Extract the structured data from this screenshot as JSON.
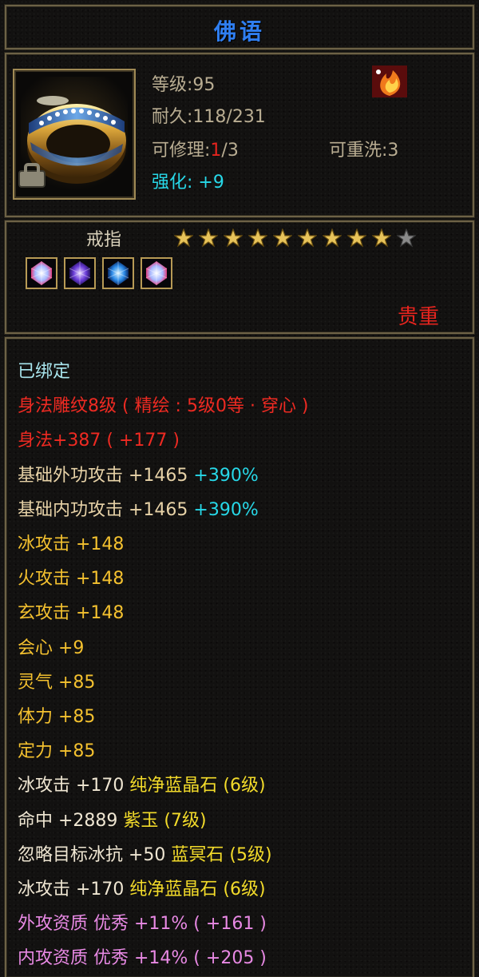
{
  "title": "佛语",
  "info": {
    "level": "等级:95",
    "durability": "耐久:118/231",
    "repair_label": "可修理:",
    "repair_current": "1",
    "repair_max": "/3",
    "rewash": "可重洗:3",
    "enhance_label": "强化:",
    "enhance_value": "+9"
  },
  "item": {
    "type": "戒指",
    "stars_filled": 9,
    "stars_total": 10,
    "rarity": "贵重",
    "gems": [
      "gem-crystal-icon",
      "gem-violet-icon",
      "gem-blue-icon",
      "gem-crystal-icon"
    ]
  },
  "colors": {
    "title": "#2f7ef0",
    "red": "#e5241e",
    "cyan": "#27d8e8",
    "gold": "#f4c12f",
    "pink": "#e889e4",
    "border": "#6d6246"
  },
  "attributes": [
    {
      "segments": [
        {
          "text": "已绑定",
          "color": "bind"
        }
      ]
    },
    {
      "segments": [
        {
          "text": "身法雕纹8级 ( 精绘 : 5级0等 · 穿心 )",
          "color": "red"
        }
      ]
    },
    {
      "segments": [
        {
          "text": "身法+387 ( +177 )",
          "color": "red"
        }
      ]
    },
    {
      "segments": [
        {
          "text": "基础外功攻击 +1465 ",
          "color": "tan"
        },
        {
          "text": "+390%",
          "color": "cyan"
        }
      ]
    },
    {
      "segments": [
        {
          "text": "基础内功攻击 +1465 ",
          "color": "tan"
        },
        {
          "text": "+390%",
          "color": "cyan"
        }
      ]
    },
    {
      "segments": [
        {
          "text": "冰攻击 +148",
          "color": "gold"
        }
      ]
    },
    {
      "segments": [
        {
          "text": "火攻击 +148",
          "color": "gold"
        }
      ]
    },
    {
      "segments": [
        {
          "text": "玄攻击 +148",
          "color": "gold"
        }
      ]
    },
    {
      "segments": [
        {
          "text": "会心 +9",
          "color": "gold"
        }
      ]
    },
    {
      "segments": [
        {
          "text": "灵气 +85",
          "color": "gold"
        }
      ]
    },
    {
      "segments": [
        {
          "text": "体力 +85",
          "color": "gold"
        }
      ]
    },
    {
      "segments": [
        {
          "text": "定力 +85",
          "color": "gold"
        }
      ]
    },
    {
      "segments": [
        {
          "text": "冰攻击 +170 ",
          "color": "white"
        },
        {
          "text": "纯净蓝晶石 (6级)",
          "color": "yel"
        }
      ]
    },
    {
      "segments": [
        {
          "text": "命中 +2889 ",
          "color": "white"
        },
        {
          "text": "紫玉 (7级)",
          "color": "yel"
        }
      ]
    },
    {
      "segments": [
        {
          "text": "忽略目标冰抗 +50 ",
          "color": "white"
        },
        {
          "text": "蓝冥石 (5级)",
          "color": "yel"
        }
      ]
    },
    {
      "segments": [
        {
          "text": "冰攻击 +170 ",
          "color": "white"
        },
        {
          "text": "纯净蓝晶石 (6级)",
          "color": "yel"
        }
      ]
    },
    {
      "segments": [
        {
          "text": "外攻资质  优秀 +11% ( +161 )",
          "color": "pink"
        }
      ]
    },
    {
      "segments": [
        {
          "text": "内攻资质  优秀 +14% ( +205 )",
          "color": "pink"
        }
      ]
    }
  ]
}
